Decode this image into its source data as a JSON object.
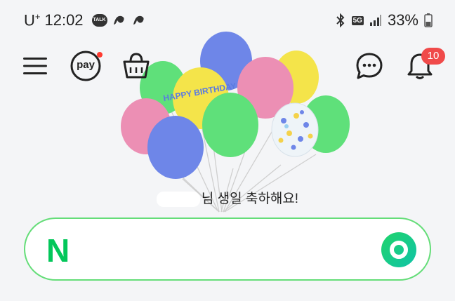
{
  "status_bar": {
    "carrier": "U",
    "carrier_sup": "+",
    "time": "12:02",
    "kakao_badge": "TALK",
    "network": "5G",
    "battery": "33%",
    "icons": [
      "talk-icon",
      "thread-icon",
      "thread-icon",
      "bluetooth-icon",
      "signal-icon",
      "battery-icon"
    ]
  },
  "header": {
    "pay_label": "pay",
    "notification_count": "10",
    "icons": [
      "menu-icon",
      "pay-icon",
      "shopping-icon",
      "chat-icon",
      "bell-icon"
    ]
  },
  "greeting": {
    "text": "님 생일 축하해요!",
    "balloon_text": "HAPPY BIRTHDAY"
  },
  "search": {
    "logo": "N",
    "placeholder": "",
    "value": "",
    "icons": [
      "lens-icon"
    ]
  },
  "colors": {
    "accent_green": "#03c75a",
    "border_green": "#64dd78",
    "badge_red": "#f04a4a",
    "balloon_blue": "#6e86e8",
    "balloon_green": "#5fe07a",
    "balloon_pink": "#ec8fb4",
    "balloon_yellow": "#f4e44a"
  }
}
